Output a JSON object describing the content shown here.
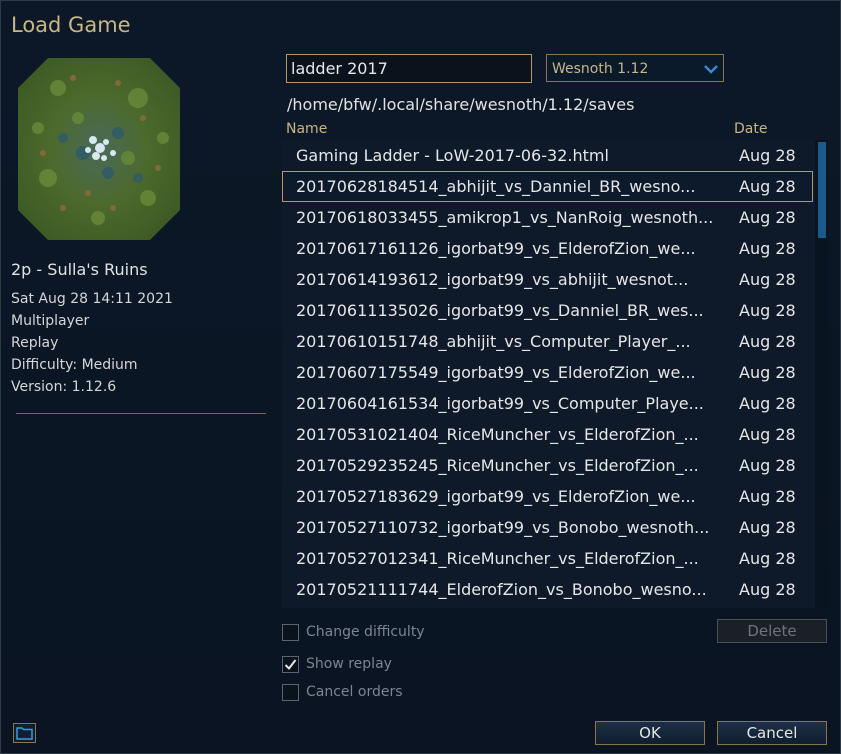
{
  "dialog": {
    "title": "Load Game"
  },
  "preview": {
    "scenario_name": "2p - Sulla's Ruins",
    "info": [
      "Sat Aug 28 14:11 2021",
      "Multiplayer",
      "Replay",
      "Difficulty: Medium",
      "Version: 1.12.6"
    ]
  },
  "filter": {
    "value": "ladder 2017"
  },
  "version_select": {
    "selected": "Wesnoth 1.12"
  },
  "path": "/home/bfw/.local/share/wesnoth/1.12/saves",
  "columns": {
    "name": "Name",
    "date": "Date"
  },
  "files": [
    {
      "name": "Gaming Ladder - LoW-2017-06-32.html",
      "date": "Aug 28"
    },
    {
      "name": "20170628184514_abhijit_vs_Danniel_BR_wesno...",
      "date": "Aug 28"
    },
    {
      "name": "20170618033455_amikrop1_vs_NanRoig_wesnoth...",
      "date": "Aug 28"
    },
    {
      "name": "20170617161126_igorbat99_vs_ElderofZion_we...",
      "date": "Aug 28"
    },
    {
      "name": "20170614193612_igorbat99_vs_abhijit_wesnot...",
      "date": "Aug 28"
    },
    {
      "name": "20170611135026_igorbat99_vs_Danniel_BR_wes...",
      "date": "Aug 28"
    },
    {
      "name": "20170610151748_abhijit_vs_Computer_Player_...",
      "date": "Aug 28"
    },
    {
      "name": "20170607175549_igorbat99_vs_ElderofZion_we...",
      "date": "Aug 28"
    },
    {
      "name": "20170604161534_igorbat99_vs_Computer_Playe...",
      "date": "Aug 28"
    },
    {
      "name": "20170531021404_RiceMuncher_vs_ElderofZion_...",
      "date": "Aug 28"
    },
    {
      "name": "20170529235245_RiceMuncher_vs_ElderofZion_...",
      "date": "Aug 28"
    },
    {
      "name": "20170527183629_igorbat99_vs_ElderofZion_we...",
      "date": "Aug 28"
    },
    {
      "name": "20170527110732_igorbat99_vs_Bonobo_wesnoth...",
      "date": "Aug 28"
    },
    {
      "name": "20170527012341_RiceMuncher_vs_ElderofZion_...",
      "date": "Aug 28"
    },
    {
      "name": "20170521111744_ElderofZion_vs_Bonobo_wesno...",
      "date": "Aug 28"
    }
  ],
  "selected_index": 1,
  "options": {
    "change_difficulty": "Change difficulty",
    "show_replay": "Show replay",
    "cancel_orders": "Cancel orders"
  },
  "option_state": {
    "change_difficulty": false,
    "show_replay": true,
    "cancel_orders": false
  },
  "buttons": {
    "delete": "Delete",
    "ok": "OK",
    "cancel": "Cancel"
  },
  "icons": {
    "dropdown": "chevron-down-icon",
    "folder": "folder-icon",
    "check": "checkmark-icon"
  },
  "colors": {
    "accent_gold": "#c8b686",
    "selection_border": "#b89a5c",
    "scroll_thumb": "#1b5a8c"
  }
}
